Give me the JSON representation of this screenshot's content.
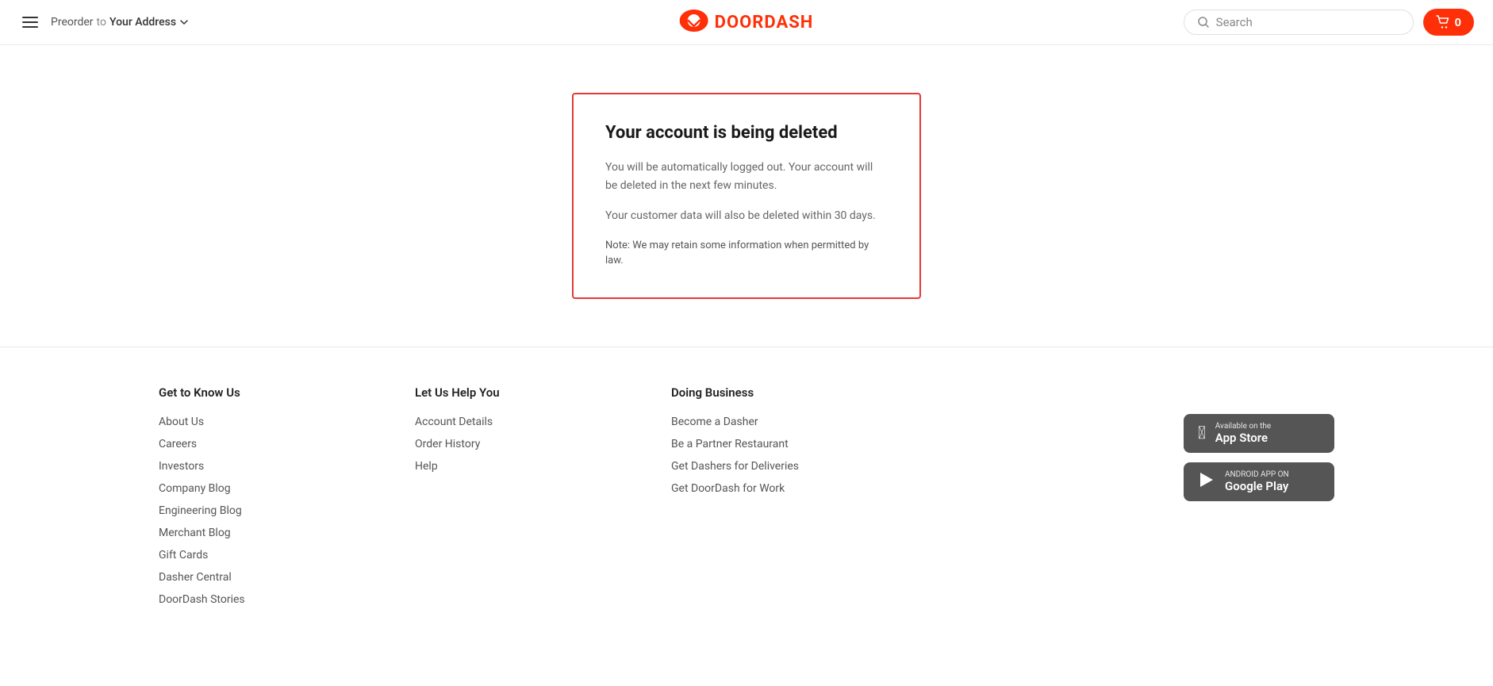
{
  "header": {
    "preorder_label": "Preorder",
    "to_text": "to",
    "address_text": "Your Address",
    "logo_name": "DOORDASH",
    "search_placeholder": "Search",
    "cart_count": "0"
  },
  "deletion_card": {
    "title": "Your account is being deleted",
    "body1": "You will be automatically logged out. Your account will be deleted in the next few minutes.",
    "body2": "Your customer data will also be deleted within 30 days.",
    "note": "Note: We may retain some information when permitted by law."
  },
  "footer": {
    "col1_title": "Get to Know Us",
    "col1_links": [
      "About Us",
      "Careers",
      "Investors",
      "Company Blog",
      "Engineering Blog",
      "Merchant Blog",
      "Gift Cards",
      "Dasher Central",
      "DoorDash Stories"
    ],
    "col2_title": "Let Us Help You",
    "col2_links": [
      "Account Details",
      "Order History",
      "Help"
    ],
    "col3_title": "Doing Business",
    "col3_links": [
      "Become a Dasher",
      "Be a Partner Restaurant",
      "Get Dashers for Deliveries",
      "Get DoorDash for Work"
    ],
    "appstore_sub": "Available on the",
    "appstore_main": "App Store",
    "googleplay_sub": "ANDROID APP ON",
    "googleplay_main": "Google Play"
  }
}
